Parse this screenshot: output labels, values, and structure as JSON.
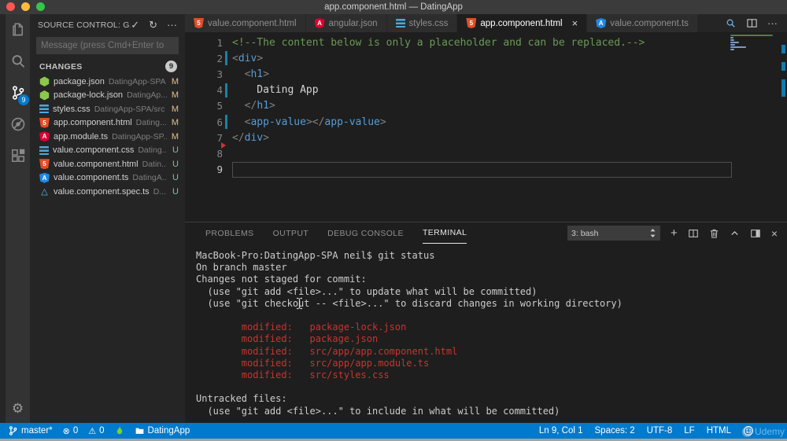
{
  "window": {
    "title": "app.component.html — DatingApp"
  },
  "activity_bar": {
    "items": [
      {
        "id": "explorer",
        "icon": "explorer"
      },
      {
        "id": "search",
        "icon": "search"
      },
      {
        "id": "source-control",
        "icon": "git-branch",
        "active": true,
        "badge": "9"
      },
      {
        "id": "debug",
        "icon": "debug"
      },
      {
        "id": "extensions",
        "icon": "extensions"
      }
    ],
    "settings_icon": "gear"
  },
  "sidebar": {
    "header": {
      "title": "SOURCE CONTROL: G..",
      "actions": [
        "check",
        "refresh",
        "more"
      ]
    },
    "message_placeholder": "Message (press Cmd+Enter to",
    "changes": {
      "label": "CHANGES",
      "badge": "9",
      "files": [
        {
          "name": "package.json",
          "path": "DatingApp-SPA",
          "status": "M",
          "icon": "node"
        },
        {
          "name": "package-lock.json",
          "path": "DatingAp...",
          "status": "M",
          "icon": "node"
        },
        {
          "name": "styles.css",
          "path": "DatingApp-SPA/src",
          "status": "M",
          "icon": "css"
        },
        {
          "name": "app.component.html",
          "path": "Dating...",
          "status": "M",
          "icon": "html5"
        },
        {
          "name": "app.module.ts",
          "path": "DatingApp-SP...",
          "status": "M",
          "icon": "angular-red"
        },
        {
          "name": "value.component.css",
          "path": "Dating...",
          "status": "U",
          "icon": "css"
        },
        {
          "name": "value.component.html",
          "path": "Datin...",
          "status": "U",
          "icon": "html5"
        },
        {
          "name": "value.component.ts",
          "path": "DatingA...",
          "status": "U",
          "icon": "angular-blue"
        },
        {
          "name": "value.component.spec.ts",
          "path": "D...",
          "status": "U",
          "icon": "beaker"
        }
      ]
    }
  },
  "tabs": [
    {
      "label": "value.component.html",
      "icon": "html5"
    },
    {
      "label": "angular.json",
      "icon": "angular-red"
    },
    {
      "label": "styles.css",
      "icon": "css"
    },
    {
      "label": "app.component.html",
      "icon": "html5",
      "active": true,
      "close": "×"
    },
    {
      "label": "value.component.ts",
      "icon": "angular-blue"
    }
  ],
  "tab_actions": [
    "open-preview",
    "split-editor",
    "more"
  ],
  "editor": {
    "lines": [
      {
        "n": "1",
        "tokens": [
          {
            "c": "comment",
            "t": "<!--The content below is only a placeholder and can be replaced.-->"
          }
        ]
      },
      {
        "n": "2",
        "mod": true,
        "tokens": [
          {
            "c": "punct",
            "t": "<"
          },
          {
            "c": "tag",
            "t": "div"
          },
          {
            "c": "punct",
            "t": ">"
          }
        ]
      },
      {
        "n": "3",
        "tokens": [
          {
            "c": "plain",
            "t": "  "
          },
          {
            "c": "punct",
            "t": "<"
          },
          {
            "c": "tag",
            "t": "h1"
          },
          {
            "c": "punct",
            "t": ">"
          }
        ]
      },
      {
        "n": "4",
        "mod": true,
        "tokens": [
          {
            "c": "plain",
            "t": "    Dating App"
          }
        ]
      },
      {
        "n": "5",
        "tokens": [
          {
            "c": "plain",
            "t": "  "
          },
          {
            "c": "punct",
            "t": "</"
          },
          {
            "c": "tag",
            "t": "h1"
          },
          {
            "c": "punct",
            "t": ">"
          }
        ]
      },
      {
        "n": "6",
        "mod": true,
        "tokens": [
          {
            "c": "plain",
            "t": "  "
          },
          {
            "c": "punct",
            "t": "<"
          },
          {
            "c": "tag",
            "t": "app-value"
          },
          {
            "c": "punct",
            "t": "></"
          },
          {
            "c": "tag",
            "t": "app-value"
          },
          {
            "c": "punct",
            "t": ">"
          }
        ]
      },
      {
        "n": "7",
        "del_after": true,
        "tokens": [
          {
            "c": "punct",
            "t": "</"
          },
          {
            "c": "tag",
            "t": "div"
          },
          {
            "c": "punct",
            "t": ">"
          }
        ]
      },
      {
        "n": "8",
        "tokens": []
      },
      {
        "n": "9",
        "current": true,
        "tokens": []
      }
    ]
  },
  "panel": {
    "tabs": [
      {
        "label": "PROBLEMS"
      },
      {
        "label": "OUTPUT"
      },
      {
        "label": "DEBUG CONSOLE"
      },
      {
        "label": "TERMINAL",
        "active": true
      }
    ],
    "shell_label": "3: bash",
    "actions": [
      "plus",
      "split-editor",
      "trash",
      "chevron-up",
      "panel-max",
      "close"
    ],
    "terminal_lines": [
      {
        "c": "fg",
        "t": "MacBook-Pro:DatingApp-SPA neil$ git status"
      },
      {
        "c": "fg",
        "t": "On branch master"
      },
      {
        "c": "fg",
        "t": "Changes not staged for commit:"
      },
      {
        "c": "fg",
        "t": "  (use \"git add <file>...\" to update what will be committed)"
      },
      {
        "c": "fg",
        "t": "  (use \"git checkout -- <file>...\" to discard changes in working directory)"
      },
      {
        "c": "fg",
        "t": ""
      },
      {
        "c": "red",
        "t": "        modified:   package-lock.json"
      },
      {
        "c": "red",
        "t": "        modified:   package.json"
      },
      {
        "c": "red",
        "t": "        modified:   src/app/app.component.html"
      },
      {
        "c": "red",
        "t": "        modified:   src/app/app.module.ts"
      },
      {
        "c": "red",
        "t": "        modified:   src/styles.css"
      },
      {
        "c": "fg",
        "t": ""
      },
      {
        "c": "fg",
        "t": "Untracked files:"
      },
      {
        "c": "fg",
        "t": "  (use \"git add <file>...\" to include in what will be committed)"
      }
    ]
  },
  "status_bar": {
    "left": [
      {
        "icon": "git-branch-sm",
        "label": "master*"
      },
      {
        "icon": "error",
        "label": "0"
      },
      {
        "icon": "warning",
        "label": "0"
      },
      {
        "icon": "flame",
        "label": ""
      },
      {
        "icon": "folder",
        "label": "DatingApp"
      }
    ],
    "right": [
      {
        "label": "Ln 9, Col 1"
      },
      {
        "label": "Spaces: 2"
      },
      {
        "label": "UTF-8"
      },
      {
        "label": "LF"
      },
      {
        "label": "HTML"
      }
    ],
    "feedback_icon": "smiley",
    "watermark": "Udemy"
  },
  "colors": {
    "status_bar": "#007acc",
    "modified_badge": "#e2c08d",
    "untracked_badge": "#73c991",
    "terminal_red": "#cd3131"
  }
}
